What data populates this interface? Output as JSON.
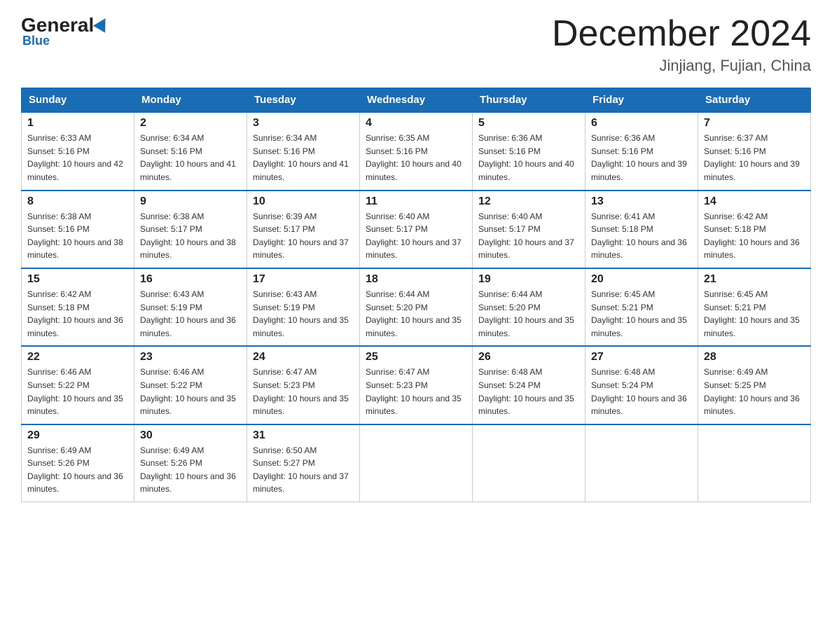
{
  "logo": {
    "general": "General",
    "blue": "Blue"
  },
  "title": "December 2024",
  "subtitle": "Jinjiang, Fujian, China",
  "weekdays": [
    "Sunday",
    "Monday",
    "Tuesday",
    "Wednesday",
    "Thursday",
    "Friday",
    "Saturday"
  ],
  "weeks": [
    [
      {
        "day": "1",
        "sunrise": "6:33 AM",
        "sunset": "5:16 PM",
        "daylight": "10 hours and 42 minutes."
      },
      {
        "day": "2",
        "sunrise": "6:34 AM",
        "sunset": "5:16 PM",
        "daylight": "10 hours and 41 minutes."
      },
      {
        "day": "3",
        "sunrise": "6:34 AM",
        "sunset": "5:16 PM",
        "daylight": "10 hours and 41 minutes."
      },
      {
        "day": "4",
        "sunrise": "6:35 AM",
        "sunset": "5:16 PM",
        "daylight": "10 hours and 40 minutes."
      },
      {
        "day": "5",
        "sunrise": "6:36 AM",
        "sunset": "5:16 PM",
        "daylight": "10 hours and 40 minutes."
      },
      {
        "day": "6",
        "sunrise": "6:36 AM",
        "sunset": "5:16 PM",
        "daylight": "10 hours and 39 minutes."
      },
      {
        "day": "7",
        "sunrise": "6:37 AM",
        "sunset": "5:16 PM",
        "daylight": "10 hours and 39 minutes."
      }
    ],
    [
      {
        "day": "8",
        "sunrise": "6:38 AM",
        "sunset": "5:16 PM",
        "daylight": "10 hours and 38 minutes."
      },
      {
        "day": "9",
        "sunrise": "6:38 AM",
        "sunset": "5:17 PM",
        "daylight": "10 hours and 38 minutes."
      },
      {
        "day": "10",
        "sunrise": "6:39 AM",
        "sunset": "5:17 PM",
        "daylight": "10 hours and 37 minutes."
      },
      {
        "day": "11",
        "sunrise": "6:40 AM",
        "sunset": "5:17 PM",
        "daylight": "10 hours and 37 minutes."
      },
      {
        "day": "12",
        "sunrise": "6:40 AM",
        "sunset": "5:17 PM",
        "daylight": "10 hours and 37 minutes."
      },
      {
        "day": "13",
        "sunrise": "6:41 AM",
        "sunset": "5:18 PM",
        "daylight": "10 hours and 36 minutes."
      },
      {
        "day": "14",
        "sunrise": "6:42 AM",
        "sunset": "5:18 PM",
        "daylight": "10 hours and 36 minutes."
      }
    ],
    [
      {
        "day": "15",
        "sunrise": "6:42 AM",
        "sunset": "5:18 PM",
        "daylight": "10 hours and 36 minutes."
      },
      {
        "day": "16",
        "sunrise": "6:43 AM",
        "sunset": "5:19 PM",
        "daylight": "10 hours and 36 minutes."
      },
      {
        "day": "17",
        "sunrise": "6:43 AM",
        "sunset": "5:19 PM",
        "daylight": "10 hours and 35 minutes."
      },
      {
        "day": "18",
        "sunrise": "6:44 AM",
        "sunset": "5:20 PM",
        "daylight": "10 hours and 35 minutes."
      },
      {
        "day": "19",
        "sunrise": "6:44 AM",
        "sunset": "5:20 PM",
        "daylight": "10 hours and 35 minutes."
      },
      {
        "day": "20",
        "sunrise": "6:45 AM",
        "sunset": "5:21 PM",
        "daylight": "10 hours and 35 minutes."
      },
      {
        "day": "21",
        "sunrise": "6:45 AM",
        "sunset": "5:21 PM",
        "daylight": "10 hours and 35 minutes."
      }
    ],
    [
      {
        "day": "22",
        "sunrise": "6:46 AM",
        "sunset": "5:22 PM",
        "daylight": "10 hours and 35 minutes."
      },
      {
        "day": "23",
        "sunrise": "6:46 AM",
        "sunset": "5:22 PM",
        "daylight": "10 hours and 35 minutes."
      },
      {
        "day": "24",
        "sunrise": "6:47 AM",
        "sunset": "5:23 PM",
        "daylight": "10 hours and 35 minutes."
      },
      {
        "day": "25",
        "sunrise": "6:47 AM",
        "sunset": "5:23 PM",
        "daylight": "10 hours and 35 minutes."
      },
      {
        "day": "26",
        "sunrise": "6:48 AM",
        "sunset": "5:24 PM",
        "daylight": "10 hours and 35 minutes."
      },
      {
        "day": "27",
        "sunrise": "6:48 AM",
        "sunset": "5:24 PM",
        "daylight": "10 hours and 36 minutes."
      },
      {
        "day": "28",
        "sunrise": "6:49 AM",
        "sunset": "5:25 PM",
        "daylight": "10 hours and 36 minutes."
      }
    ],
    [
      {
        "day": "29",
        "sunrise": "6:49 AM",
        "sunset": "5:26 PM",
        "daylight": "10 hours and 36 minutes."
      },
      {
        "day": "30",
        "sunrise": "6:49 AM",
        "sunset": "5:26 PM",
        "daylight": "10 hours and 36 minutes."
      },
      {
        "day": "31",
        "sunrise": "6:50 AM",
        "sunset": "5:27 PM",
        "daylight": "10 hours and 37 minutes."
      },
      null,
      null,
      null,
      null
    ]
  ]
}
